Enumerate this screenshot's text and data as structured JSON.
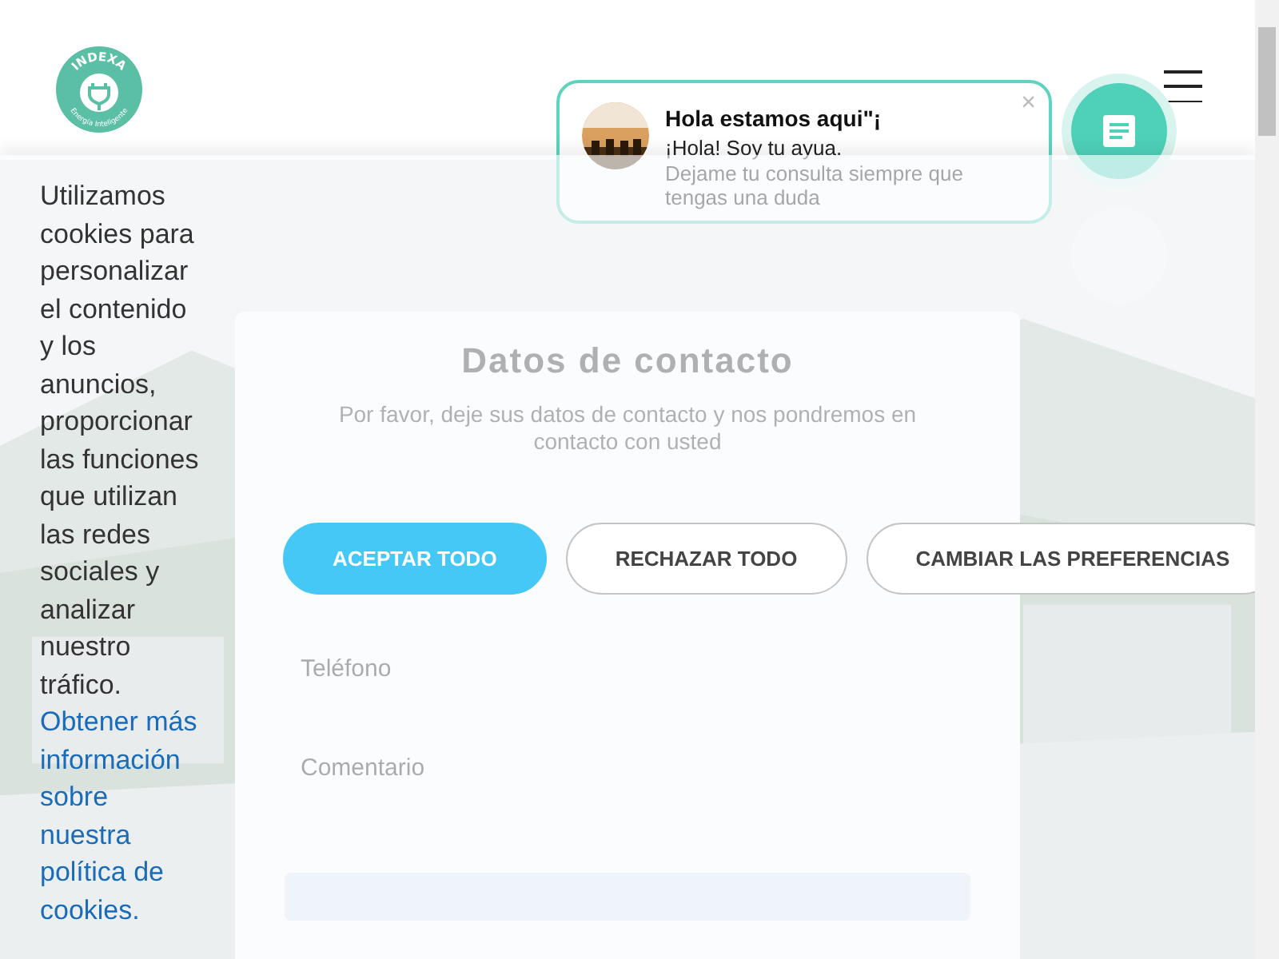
{
  "header": {
    "logo": {
      "name": "INDEXA",
      "tagline": "Energía Inteligente"
    }
  },
  "chat": {
    "title": "Hola estamos aqui\"¡",
    "greeting": "¡Hola! Soy tu ayua.",
    "message": "Dejame tu consulta siempre que tengas una duda",
    "close": "×"
  },
  "form": {
    "title": "Datos de contacto",
    "subtitle": "Por favor, deje sus datos de contacto y nos pondremos en contacto con usted",
    "fields": [
      {
        "kind": "input",
        "placeholder": "Teléfono"
      },
      {
        "kind": "textarea",
        "placeholder": "Comentario"
      }
    ]
  },
  "cookie_banner": {
    "text": "Utilizamos cookies para personalizar el contenido y los anuncios, proporcionar las funciones que utilizan las redes sociales y analizar nuestro tráfico.",
    "link": "Obtener más información sobre nuestra política de cookies.",
    "buttons": [
      {
        "label": "ACEPTAR TODO",
        "primary": true
      },
      {
        "label": "RECHAZAR TODO",
        "primary": false
      },
      {
        "label": "CAMBIAR LAS PREFERENCIAS",
        "primary": false
      }
    ]
  }
}
